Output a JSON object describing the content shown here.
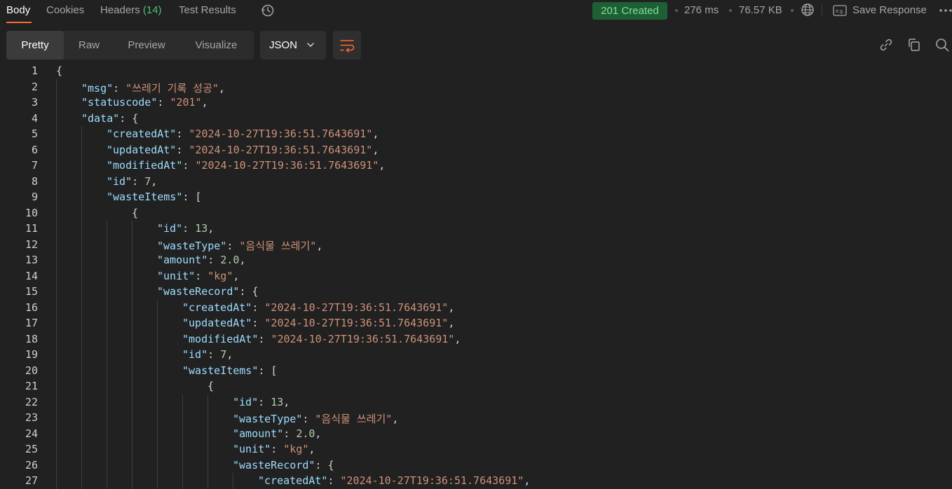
{
  "response_tabs": {
    "body": "Body",
    "cookies": "Cookies",
    "headers_label": "Headers",
    "headers_count": "(14)",
    "test_results": "Test Results"
  },
  "status": {
    "code": "201 Created",
    "time": "276 ms",
    "size": "76.57 KB",
    "save_response": "Save Response"
  },
  "view_modes": [
    "Pretty",
    "Raw",
    "Preview",
    "Visualize"
  ],
  "format": "JSON",
  "icons": {
    "history": "history-icon",
    "globe": "globe-icon",
    "save": "save-response-icon",
    "more": "more-icon",
    "wrap": "wrap-lines-icon",
    "link": "link-icon",
    "copy": "copy-icon",
    "search": "search-icon"
  },
  "colors": {
    "background": "#212121",
    "json_key": "#9cdcfe",
    "json_string": "#ce9178",
    "json_number": "#b5cea8",
    "status_bg": "#1f5f34",
    "status_text": "#7ce29b",
    "accent": "#ff6c37"
  },
  "code_lines": [
    {
      "n": "1",
      "indent": 0,
      "tokens": [
        [
          "p",
          "{"
        ]
      ]
    },
    {
      "n": "2",
      "indent": 1,
      "tokens": [
        [
          "k",
          "\"msg\""
        ],
        [
          "p",
          ": "
        ],
        [
          "s",
          "\"쓰레기 기록 성공\""
        ],
        [
          "p",
          ","
        ]
      ]
    },
    {
      "n": "3",
      "indent": 1,
      "tokens": [
        [
          "k",
          "\"statuscode\""
        ],
        [
          "p",
          ": "
        ],
        [
          "s",
          "\"201\""
        ],
        [
          "p",
          ","
        ]
      ]
    },
    {
      "n": "4",
      "indent": 1,
      "tokens": [
        [
          "k",
          "\"data\""
        ],
        [
          "p",
          ": {"
        ]
      ]
    },
    {
      "n": "5",
      "indent": 2,
      "tokens": [
        [
          "k",
          "\"createdAt\""
        ],
        [
          "p",
          ": "
        ],
        [
          "s",
          "\"2024-10-27T19:36:51.7643691\""
        ],
        [
          "p",
          ","
        ]
      ]
    },
    {
      "n": "6",
      "indent": 2,
      "tokens": [
        [
          "k",
          "\"updatedAt\""
        ],
        [
          "p",
          ": "
        ],
        [
          "s",
          "\"2024-10-27T19:36:51.7643691\""
        ],
        [
          "p",
          ","
        ]
      ]
    },
    {
      "n": "7",
      "indent": 2,
      "tokens": [
        [
          "k",
          "\"modifiedAt\""
        ],
        [
          "p",
          ": "
        ],
        [
          "s",
          "\"2024-10-27T19:36:51.7643691\""
        ],
        [
          "p",
          ","
        ]
      ]
    },
    {
      "n": "8",
      "indent": 2,
      "tokens": [
        [
          "k",
          "\"id\""
        ],
        [
          "p",
          ": "
        ],
        [
          "n",
          "7"
        ],
        [
          "p",
          ","
        ]
      ]
    },
    {
      "n": "9",
      "indent": 2,
      "tokens": [
        [
          "k",
          "\"wasteItems\""
        ],
        [
          "p",
          ": ["
        ]
      ]
    },
    {
      "n": "10",
      "indent": 3,
      "tokens": [
        [
          "p",
          "{"
        ]
      ]
    },
    {
      "n": "11",
      "indent": 4,
      "tokens": [
        [
          "k",
          "\"id\""
        ],
        [
          "p",
          ": "
        ],
        [
          "n",
          "13"
        ],
        [
          "p",
          ","
        ]
      ]
    },
    {
      "n": "12",
      "indent": 4,
      "tokens": [
        [
          "k",
          "\"wasteType\""
        ],
        [
          "p",
          ": "
        ],
        [
          "s",
          "\"음식물 쓰레기\""
        ],
        [
          "p",
          ","
        ]
      ]
    },
    {
      "n": "13",
      "indent": 4,
      "tokens": [
        [
          "k",
          "\"amount\""
        ],
        [
          "p",
          ": "
        ],
        [
          "n",
          "2.0"
        ],
        [
          "p",
          ","
        ]
      ]
    },
    {
      "n": "14",
      "indent": 4,
      "tokens": [
        [
          "k",
          "\"unit\""
        ],
        [
          "p",
          ": "
        ],
        [
          "s",
          "\"kg\""
        ],
        [
          "p",
          ","
        ]
      ]
    },
    {
      "n": "15",
      "indent": 4,
      "tokens": [
        [
          "k",
          "\"wasteRecord\""
        ],
        [
          "p",
          ": {"
        ]
      ]
    },
    {
      "n": "16",
      "indent": 5,
      "tokens": [
        [
          "k",
          "\"createdAt\""
        ],
        [
          "p",
          ": "
        ],
        [
          "s",
          "\"2024-10-27T19:36:51.7643691\""
        ],
        [
          "p",
          ","
        ]
      ]
    },
    {
      "n": "17",
      "indent": 5,
      "tokens": [
        [
          "k",
          "\"updatedAt\""
        ],
        [
          "p",
          ": "
        ],
        [
          "s",
          "\"2024-10-27T19:36:51.7643691\""
        ],
        [
          "p",
          ","
        ]
      ]
    },
    {
      "n": "18",
      "indent": 5,
      "tokens": [
        [
          "k",
          "\"modifiedAt\""
        ],
        [
          "p",
          ": "
        ],
        [
          "s",
          "\"2024-10-27T19:36:51.7643691\""
        ],
        [
          "p",
          ","
        ]
      ]
    },
    {
      "n": "19",
      "indent": 5,
      "tokens": [
        [
          "k",
          "\"id\""
        ],
        [
          "p",
          ": "
        ],
        [
          "n",
          "7"
        ],
        [
          "p",
          ","
        ]
      ]
    },
    {
      "n": "20",
      "indent": 5,
      "tokens": [
        [
          "k",
          "\"wasteItems\""
        ],
        [
          "p",
          ": ["
        ]
      ]
    },
    {
      "n": "21",
      "indent": 6,
      "tokens": [
        [
          "p",
          "{"
        ]
      ]
    },
    {
      "n": "22",
      "indent": 7,
      "tokens": [
        [
          "k",
          "\"id\""
        ],
        [
          "p",
          ": "
        ],
        [
          "n",
          "13"
        ],
        [
          "p",
          ","
        ]
      ]
    },
    {
      "n": "23",
      "indent": 7,
      "tokens": [
        [
          "k",
          "\"wasteType\""
        ],
        [
          "p",
          ": "
        ],
        [
          "s",
          "\"음식물 쓰레기\""
        ],
        [
          "p",
          ","
        ]
      ]
    },
    {
      "n": "24",
      "indent": 7,
      "tokens": [
        [
          "k",
          "\"amount\""
        ],
        [
          "p",
          ": "
        ],
        [
          "n",
          "2.0"
        ],
        [
          "p",
          ","
        ]
      ]
    },
    {
      "n": "25",
      "indent": 7,
      "tokens": [
        [
          "k",
          "\"unit\""
        ],
        [
          "p",
          ": "
        ],
        [
          "s",
          "\"kg\""
        ],
        [
          "p",
          ","
        ]
      ]
    },
    {
      "n": "26",
      "indent": 7,
      "tokens": [
        [
          "k",
          "\"wasteRecord\""
        ],
        [
          "p",
          ": {"
        ]
      ]
    },
    {
      "n": "27",
      "indent": 8,
      "tokens": [
        [
          "k",
          "\"createdAt\""
        ],
        [
          "p",
          ": "
        ],
        [
          "s",
          "\"2024-10-27T19:36:51.7643691\""
        ],
        [
          "p",
          ","
        ]
      ]
    }
  ]
}
